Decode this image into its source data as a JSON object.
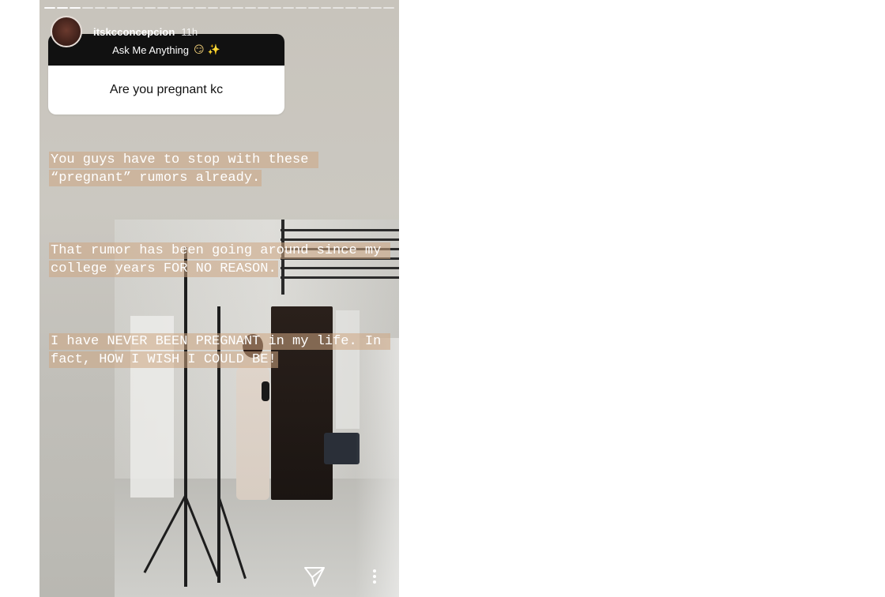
{
  "story": {
    "progress_segments": 28,
    "active_segment": 3,
    "header": {
      "username": "itskcconcepcion",
      "time": "11h",
      "avatar_icon": "avatar"
    },
    "question_sticker": {
      "title": "Ask Me Anything",
      "emojis": "😏 ✨",
      "question": "Are you pregnant kc"
    },
    "caption": {
      "paragraph1": "You guys have to stop with these “pregnant” rumors already.",
      "paragraph2": "That rumor has been going around since my college years FOR NO REASON.",
      "paragraph3": "I have NEVER BEEN PREGNANT in my life. In fact, HOW I WISH I COULD BE!"
    },
    "footer": {
      "send_icon": "send-icon",
      "more_icon": "more-options-icon"
    },
    "colors": {
      "caption_highlight": "#cda582",
      "sticker_header": "#111111",
      "sticker_body": "#ffffff"
    }
  }
}
